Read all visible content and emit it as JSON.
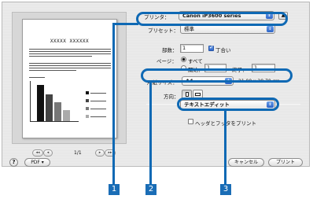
{
  "dialog": {
    "printer_label": "プリンタ：",
    "printer_value": "Canon iP3600 series",
    "preset_label": "プリセット：",
    "preset_value": "標準",
    "copies_label": "部数：",
    "copies_value": "1",
    "collate_label": "丁合い",
    "pages_label": "ページ：",
    "pages_all": "すべて",
    "pages_from_label": "開始：",
    "pages_from_value": "1",
    "pages_to_label": "終了：",
    "pages_to_value": "1",
    "paper_size_label": "用紙サイズ：",
    "paper_size_value": "A4",
    "paper_size_dims": "21.00 x 29.70 cm",
    "orientation_label": "方向：",
    "app_menu_value": "テキストエディット",
    "header_footer_label": "ヘッダとフッタをプリント",
    "help_icon": "?",
    "pdf_button": "PDF ▾",
    "cancel_button": "キャンセル",
    "print_button": "プリント"
  },
  "preview": {
    "doc_title": "XXXXX XXXXXX",
    "page_indicator": "1/1",
    "first_btn": "◂◂",
    "prev_btn": "◂",
    "next_btn": "▸",
    "last_btn": "▸▸"
  },
  "callouts": [
    "1",
    "2",
    "3"
  ],
  "colors": {
    "callout_blue": "#0f69b4",
    "popup_arrow_blue": "#2d64c8",
    "dialog_bg": "#e9e9e9"
  },
  "icons": {
    "collapse": "triangle-up-icon",
    "popup_arrows": "updown-arrows-icon",
    "portrait": "portrait-orientation-icon",
    "landscape": "landscape-orientation-icon"
  }
}
